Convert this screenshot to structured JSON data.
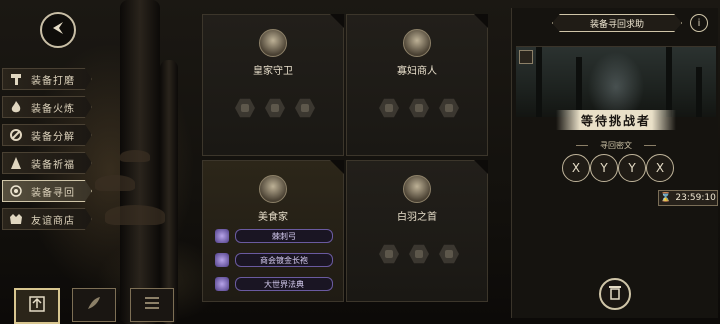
{
  "nav": {
    "items": [
      {
        "label": "装备打磨",
        "icon": "hammer-icon"
      },
      {
        "label": "装备火炼",
        "icon": "flame-icon"
      },
      {
        "label": "装备分解",
        "icon": "disassemble-icon"
      },
      {
        "label": "装备祈福",
        "icon": "prayer-icon"
      },
      {
        "label": "装备寻回",
        "icon": "retrieve-icon",
        "active": true
      },
      {
        "label": "友谊商店",
        "icon": "shop-icon"
      }
    ],
    "bottom": [
      {
        "icon": "upload-icon",
        "selected": true
      },
      {
        "icon": "feather-icon",
        "selected": false
      },
      {
        "icon": "list-icon",
        "selected": false
      }
    ]
  },
  "cards": [
    {
      "name": "皇家守卫",
      "portrait": "royal-guard-portrait"
    },
    {
      "name": "寡妇商人",
      "portrait": "widow-merchant-portrait"
    },
    {
      "name": "美食家",
      "portrait": "gourmet-portrait",
      "items": [
        "棘刺弓",
        "商会镀金长袍",
        "大世界法典"
      ]
    },
    {
      "name": "白羽之首",
      "portrait": "white-feather-portrait"
    }
  ],
  "panel": {
    "title": "装备寻回求助",
    "info": "i",
    "status": "等待挑战者",
    "runes_title": "寻回密文",
    "runes": [
      "X",
      "Y",
      "Y",
      "X"
    ],
    "timer": "23:59:10"
  },
  "colors": {
    "accent": "#cfc5a8",
    "equip": "#6a5aa0"
  }
}
